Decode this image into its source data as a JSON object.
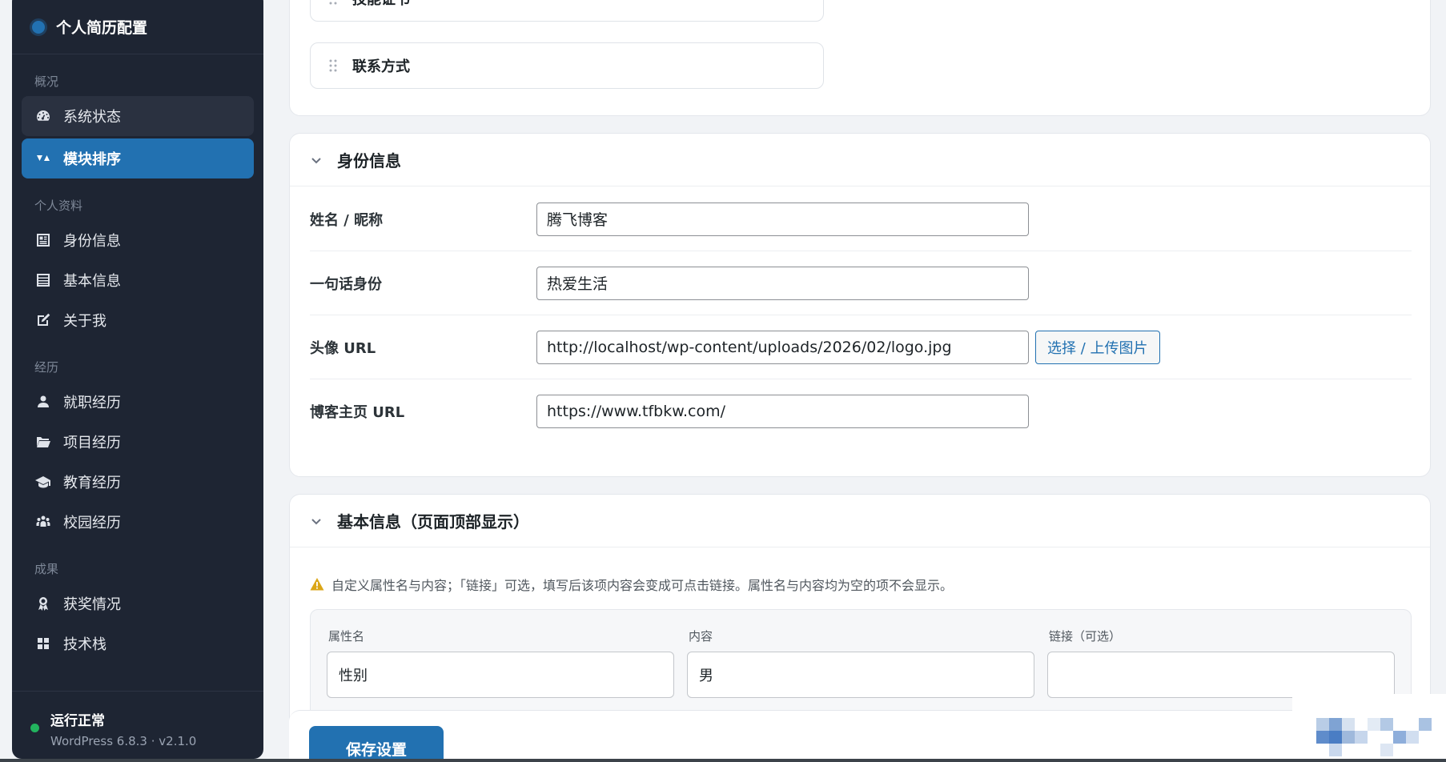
{
  "sidebar": {
    "title": "个人简历配置",
    "groups": [
      {
        "label": "概况",
        "items": [
          {
            "label": "系统状态",
            "icon": "dashboard-icon"
          },
          {
            "label": "模块排序",
            "icon": "sort-icon"
          }
        ]
      },
      {
        "label": "个人资料",
        "items": [
          {
            "label": "身份信息",
            "icon": "id-card-icon"
          },
          {
            "label": "基本信息",
            "icon": "list-icon"
          },
          {
            "label": "关于我",
            "icon": "edit-icon"
          }
        ]
      },
      {
        "label": "经历",
        "items": [
          {
            "label": "就职经历",
            "icon": "user-icon"
          },
          {
            "label": "项目经历",
            "icon": "folder-icon"
          },
          {
            "label": "教育经历",
            "icon": "graduation-cap-icon"
          },
          {
            "label": "校园经历",
            "icon": "group-icon"
          }
        ]
      },
      {
        "label": "成果",
        "items": [
          {
            "label": "获奖情况",
            "icon": "award-icon"
          },
          {
            "label": "技术栈",
            "icon": "grid-icon"
          }
        ]
      }
    ],
    "active_item": "模块排序",
    "status_text": "运行正常",
    "version": "WordPress 6.8.3 · v2.1.0",
    "status_color": "#22b35e"
  },
  "modules": {
    "items": [
      "技能证书",
      "联系方式"
    ]
  },
  "identity": {
    "title": "身份信息",
    "fields": [
      {
        "label": "姓名 / 昵称",
        "value": "腾飞博客"
      },
      {
        "label": "一句话身份",
        "value": "热爱生活"
      },
      {
        "label": "头像 URL",
        "value": "http://localhost/wp-content/uploads/2026/02/logo.jpg"
      },
      {
        "label": "博客主页 URL",
        "value": "https://www.tfbkw.com/"
      }
    ],
    "upload_button": "选择 / 上传图片"
  },
  "basic": {
    "title": "基本信息（页面顶部显示）",
    "notice": "自定义属性名与内容；「链接」可选，填写后该项内容会变成可点击链接。属性名与内容均为空的项不会显示。",
    "columns": [
      "属性名",
      "内容",
      "链接（可选）"
    ],
    "rows": [
      {
        "name": "性别",
        "content": "男",
        "link": ""
      }
    ]
  },
  "save_button": "保存设置",
  "colors": {
    "accent": "#2271b1",
    "sidebar_bg": "#1e2533",
    "warning": "#dba617"
  }
}
